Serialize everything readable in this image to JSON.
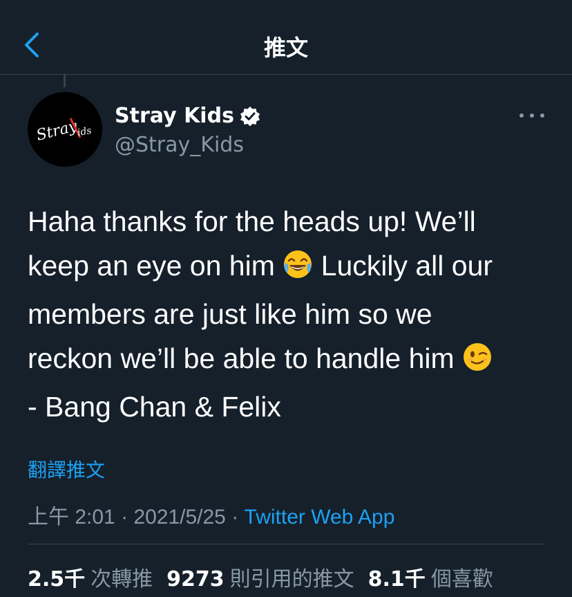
{
  "header": {
    "title": "推文"
  },
  "author": {
    "display_name": "Stray Kids",
    "handle": "@Stray_Kids",
    "verified": true,
    "avatar_logo_text": "StrayKids"
  },
  "tweet": {
    "line1": "Haha thanks for the heads up! We’ll",
    "line2a": "keep an eye on him ",
    "line2b": " Luckily all our",
    "line3": "members are just like him so we",
    "line4": "reckon we’ll be able to handle him ",
    "line5": "- Bang Chan & Felix",
    "emoji1": "face-with-tears-of-joy-icon",
    "emoji2": "winking-face-icon"
  },
  "translate_label": "翻譯推文",
  "meta": {
    "time": "上午 2:01",
    "sep1": " · ",
    "date": "2021/5/25",
    "sep2": " · ",
    "app": "Twitter Web App"
  },
  "stats": {
    "retweets_count": "2.5千",
    "retweets_label": "次轉推",
    "quotes_count": "9273",
    "quotes_label": "則引用的推文",
    "likes_count": "8.1千",
    "likes_label": "個喜歡"
  },
  "colors": {
    "background": "#15202b",
    "accent": "#1da1f2",
    "secondary_text": "#8899a6",
    "border": "#38444d"
  }
}
